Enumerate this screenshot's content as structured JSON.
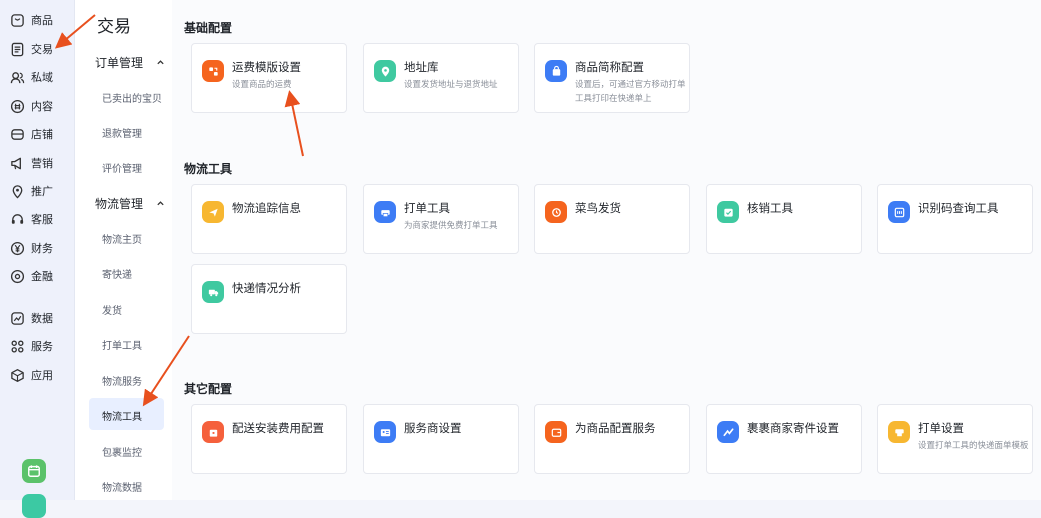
{
  "rail": {
    "items": [
      {
        "label": "商品",
        "icon": "bag-icon"
      },
      {
        "label": "交易",
        "icon": "document-icon"
      },
      {
        "label": "私域",
        "icon": "users-icon"
      },
      {
        "label": "内容",
        "icon": "content-icon"
      },
      {
        "label": "店铺",
        "icon": "store-icon"
      },
      {
        "label": "营销",
        "icon": "megaphone-icon"
      },
      {
        "label": "推广",
        "icon": "location-icon"
      },
      {
        "label": "客服",
        "icon": "headset-icon"
      },
      {
        "label": "财务",
        "icon": "yen-icon"
      },
      {
        "label": "金融",
        "icon": "finance-icon"
      },
      {
        "label": "数据",
        "icon": "chart-icon"
      },
      {
        "label": "服务",
        "icon": "grid-icon"
      },
      {
        "label": "应用",
        "icon": "apps-icon"
      }
    ]
  },
  "subnav": {
    "title": "交易",
    "group1": {
      "label": "订单管理",
      "items": [
        "已卖出的宝贝",
        "退款管理",
        "评价管理"
      ]
    },
    "group2": {
      "label": "物流管理",
      "items": [
        "物流主页",
        "寄快递",
        "发货",
        "打单工具",
        "物流服务",
        "物流工具",
        "包裹监控",
        "物流数据"
      ]
    },
    "active_item": "物流工具"
  },
  "sections": {
    "basic": {
      "title": "基础配置",
      "cards": [
        {
          "title": "运费模版设置",
          "desc": "设置商品的运费",
          "color": "#f5641e"
        },
        {
          "title": "地址库",
          "desc": "设置发货地址与退货地址",
          "color": "#3fc9a0"
        },
        {
          "title": "商品简称配置",
          "desc": "设置后，可通过官方移动打单工具打印在快递单上",
          "color": "#3d7cf5"
        }
      ]
    },
    "logistics": {
      "title": "物流工具",
      "cards": [
        {
          "title": "物流追踪信息",
          "desc": "",
          "color": "#f7b731"
        },
        {
          "title": "打单工具",
          "desc": "为商家提供免费打单工具",
          "color": "#3d7cf5"
        },
        {
          "title": "菜鸟发货",
          "desc": "",
          "color": "#f5641e"
        },
        {
          "title": "核销工具",
          "desc": "",
          "color": "#3fc9a0"
        },
        {
          "title": "识别码查询工具",
          "desc": "",
          "color": "#3d7cf5"
        },
        {
          "title": "快递情况分析",
          "desc": "",
          "color": "#3fc9a0"
        }
      ]
    },
    "other": {
      "title": "其它配置",
      "cards": [
        {
          "title": "配送安装费用配置",
          "desc": "",
          "color": "#f5603c"
        },
        {
          "title": "服务商设置",
          "desc": "",
          "color": "#3d7cf5"
        },
        {
          "title": "为商品配置服务",
          "desc": "",
          "color": "#f5641e"
        },
        {
          "title": "裹裹商家寄件设置",
          "desc": "",
          "color": "#3d7cf5"
        },
        {
          "title": "打单设置",
          "desc": "设置打单工具的快递面单模板",
          "color": "#f7b731"
        }
      ]
    }
  },
  "colors": {
    "accent": "#3d7cf5",
    "arrow": "#e8501e",
    "active_bg": "#e8efff"
  }
}
